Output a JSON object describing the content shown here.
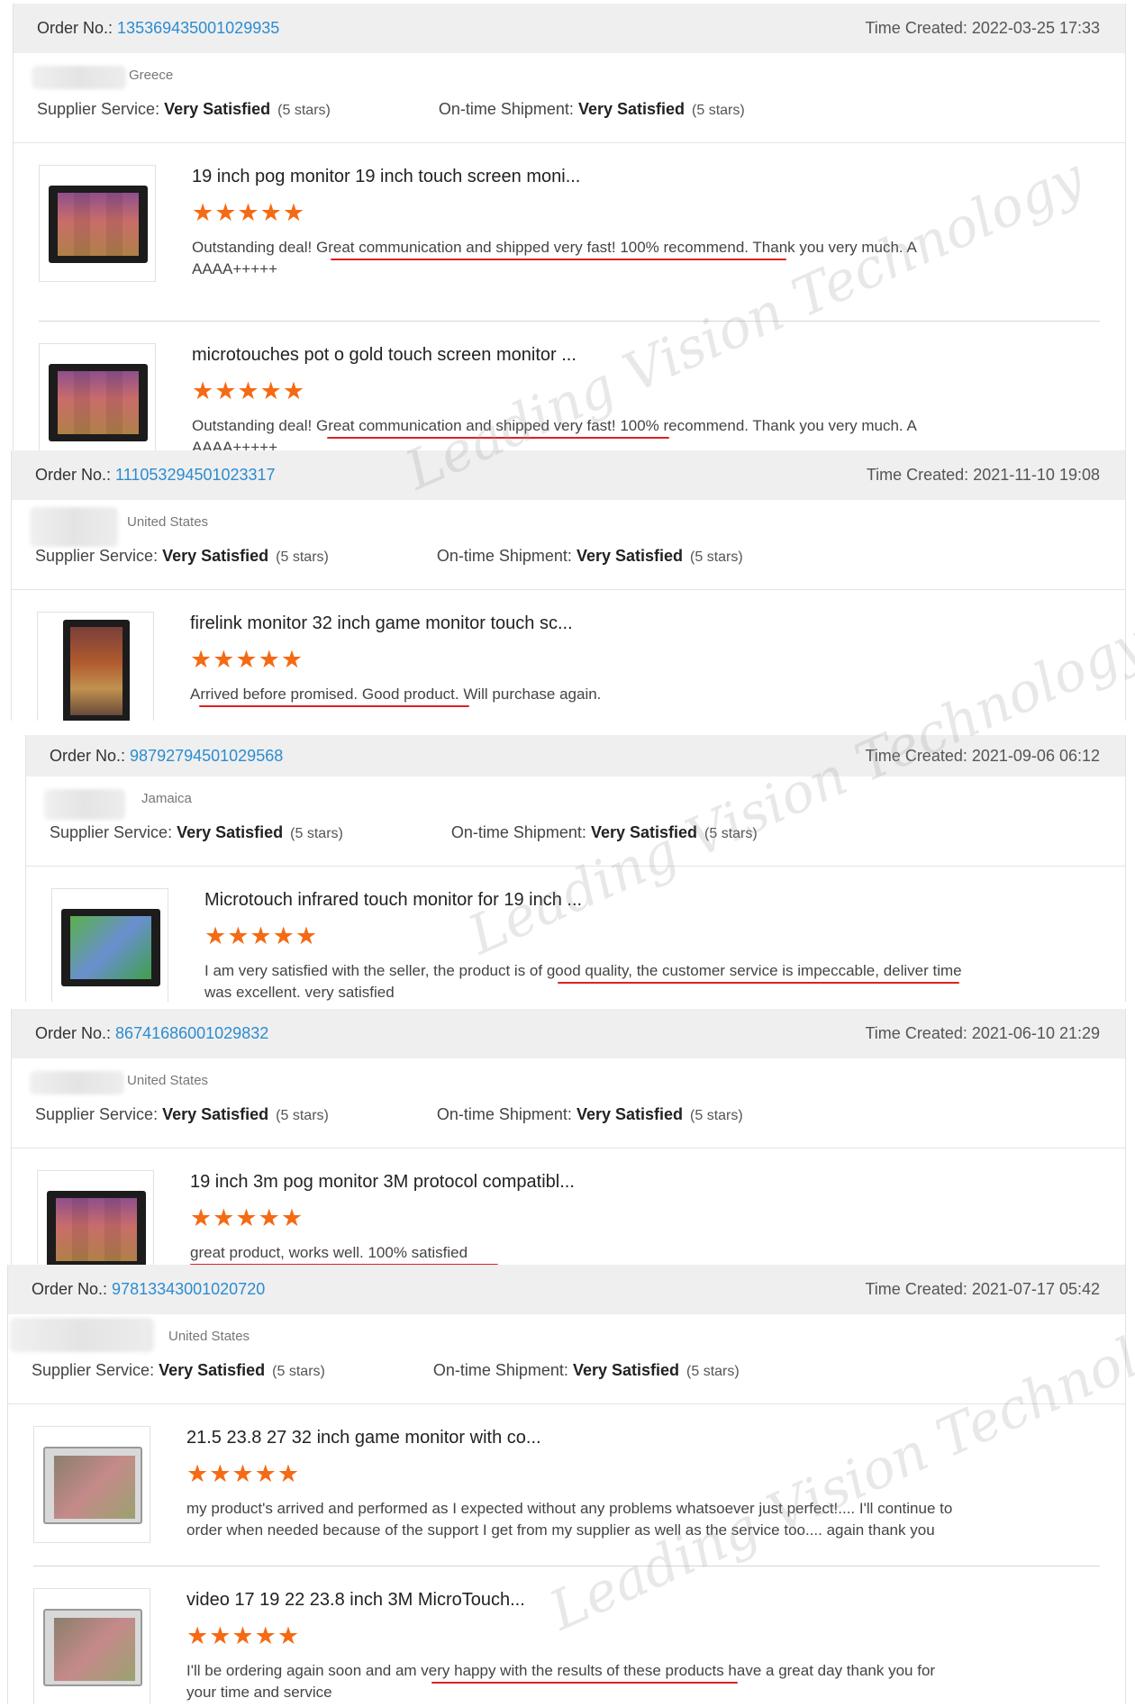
{
  "labels": {
    "order_no": "Order No.:",
    "time_created": "Time Created:",
    "supplier_service": "Supplier Service:",
    "shipment": "On-time Shipment:"
  },
  "stars_glyph": "★★★★★",
  "watermark": "Leading Vision Technology",
  "accent_color": "#f56a14",
  "link_color": "#2c8cd0",
  "orders": [
    {
      "order_no": "135369435001029935",
      "time": "2022-03-25 17:33",
      "country": "Greece",
      "supplier_rating": "Very Satisfied",
      "supplier_stars": "(5 stars)",
      "shipment_rating": "Very Satisfied",
      "shipment_stars": "(5 stars)",
      "products": [
        {
          "title": "19 inch pog monitor 19 inch touch screen moni...",
          "review": "Outstanding deal! Great communication and shipped very fast! 100% recommend. Thank you very much. A AAAA+++++"
        },
        {
          "title": "microtouches pot o gold touch screen monitor ...",
          "review": "Outstanding deal! Great communication and shipped very fast! 100% recommend. Thank you very much. A AAAA+++++"
        }
      ]
    },
    {
      "order_no": "111053294501023317",
      "time": "2021-11-10 19:08",
      "country": "United States",
      "supplier_rating": "Very Satisfied",
      "supplier_stars": "(5 stars)",
      "shipment_rating": "Very Satisfied",
      "shipment_stars": "(5 stars)",
      "products": [
        {
          "title": "firelink monitor 32 inch game monitor touch sc...",
          "review": "Arrived before promised. Good product.  Will purchase again."
        }
      ]
    },
    {
      "order_no": "98792794501029568",
      "time": "2021-09-06 06:12",
      "country": "Jamaica",
      "supplier_rating": "Very Satisfied",
      "supplier_stars": "(5 stars)",
      "shipment_rating": "Very Satisfied",
      "shipment_stars": "(5 stars)",
      "products": [
        {
          "title": "Microtouch infrared touch monitor for 19 inch ...",
          "review": "I am very satisfied with the seller, the product is of good quality, the customer service is impeccable, deliver time was excellent. very satisfied"
        }
      ]
    },
    {
      "order_no": "86741686001029832",
      "time": "2021-06-10 21:29",
      "country": "United States",
      "supplier_rating": "Very Satisfied",
      "supplier_stars": "(5 stars)",
      "shipment_rating": "Very Satisfied",
      "shipment_stars": "(5 stars)",
      "products": [
        {
          "title": "19 inch 3m pog monitor 3M protocol compatibl...",
          "review": "great product, works well. 100% satisfied"
        }
      ]
    },
    {
      "order_no": "97813343001020720",
      "time": "2021-07-17 05:42",
      "country": "United States",
      "supplier_rating": "Very Satisfied",
      "supplier_stars": "(5 stars)",
      "shipment_rating": "Very Satisfied",
      "shipment_stars": "(5 stars)",
      "products": [
        {
          "title": "21.5 23.8 27 32 inch game monitor with co...",
          "review": "my product's arrived and performed as I expected without any problems whatsoever just perfect!.... I'll continue to order when needed because of the support I get from my supplier as well as the service too.... again thank you"
        },
        {
          "title": "video 17 19 22 23.8 inch 3M MicroTouch...",
          "review": "I'll be ordering again soon and am very happy with the results of these products have a great day thank you for your time and service"
        }
      ]
    }
  ]
}
